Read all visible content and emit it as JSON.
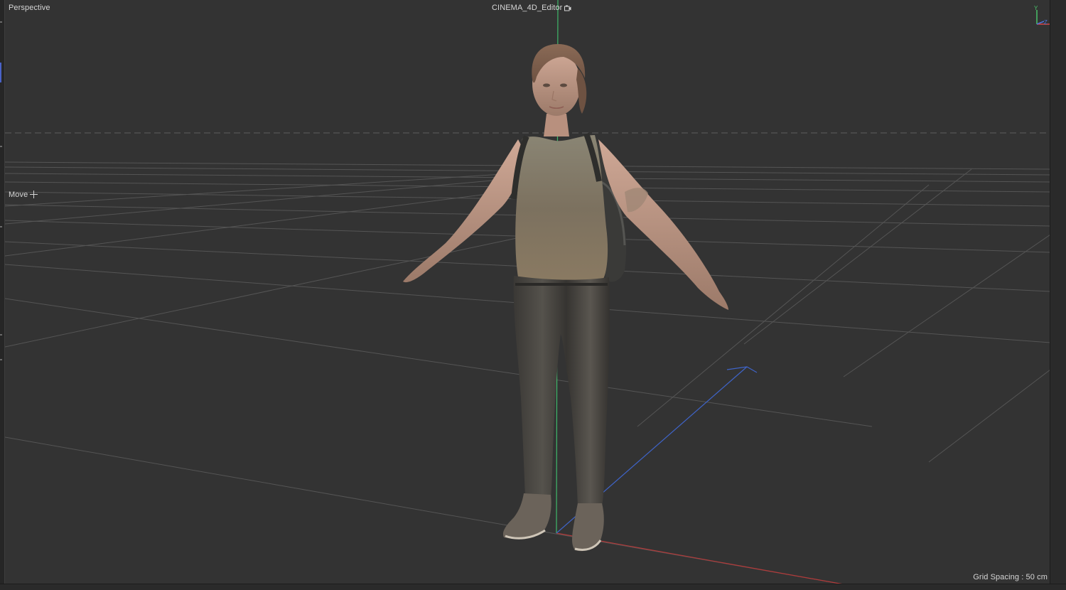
{
  "viewport": {
    "camera_label": "Perspective",
    "editor_camera_label": "CINEMA_4D_Editor",
    "tool_label": "Move",
    "grid_spacing_label": "Grid Spacing : 50 cm"
  },
  "axis_gizmo": {
    "y_label": "Y",
    "z_label": "Z",
    "x_label": "X",
    "colors": {
      "x": "#d64545",
      "y": "#49c26a",
      "z": "#4f74d9"
    }
  },
  "scene": {
    "background_color": "#333333",
    "grid_color": "#5a5a5a",
    "horizon_color": "#5e5e5e",
    "axis_colors": {
      "x": "#b23a3a",
      "y": "#3fb86a",
      "z": "#3f64c8"
    },
    "object": "character-model"
  },
  "icons": {
    "camera": "camera-icon",
    "move": "move-cross-icon",
    "axis": "axis-gizmo-icon"
  }
}
